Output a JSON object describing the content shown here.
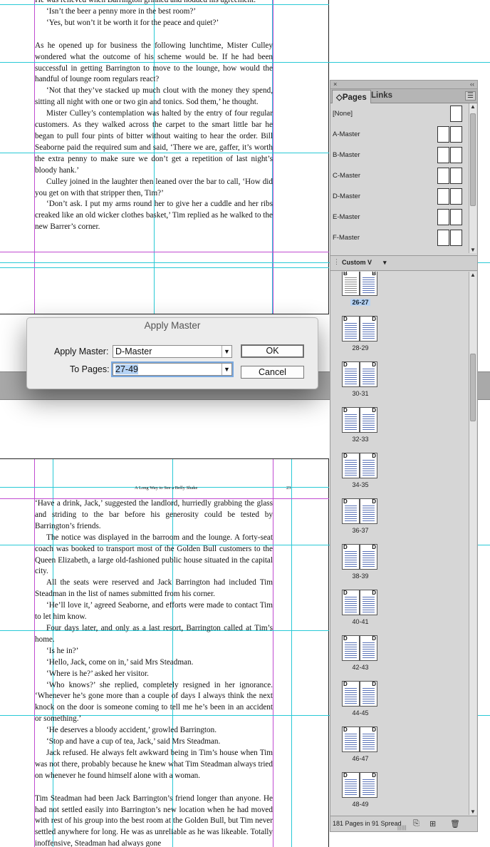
{
  "document": {
    "top_text": [
      {
        "cls": "noind",
        "text": "He was relieved when Barrington grinned and nodded his agreement."
      },
      {
        "cls": "",
        "text": "‘Isn’t the beer a penny more in the best room?’"
      },
      {
        "cls": "",
        "text": "‘Yes, but won’t it be worth it for the peace and quiet?’"
      },
      {
        "cls": "noind gap",
        "text": "As he opened up for business the following lunchtime, Mister Culley wondered what the outcome of his scheme would be. If he had been successful in getting Barrington to move to the lounge, how would the handful of lounge room regulars react?"
      },
      {
        "cls": "",
        "text": "‘Not that they’ve stacked up much clout with the money they spend, sitting all night with one or two gin and tonics. Sod them,’ he thought."
      },
      {
        "cls": "",
        "text": "Mister Culley’s contemplation was halted by the entry of four regular customers. As they walked across the carpet to the smart little bar he began to pull four pints of bitter without waiting to hear the order. Bill Seaborne paid the required sum and said, ‘There we are, gaffer, it’s worth the extra penny to make sure we don’t get a repetition of last night’s bloody hank.’"
      },
      {
        "cls": "",
        "text": "Culley joined in the laughter then leaned over the bar to call, ‘How did you get on with that stripper then, Tim?’"
      },
      {
        "cls": "",
        "text": "‘Don’t ask. I put my arms round her to give her a cuddle and her ribs creaked like an old wicker clothes basket,’ Tim replied as he walked to the new Barrer’s corner."
      }
    ],
    "running_head": "A Long Way to See a Belly Shake",
    "folio": "23",
    "bottom_text": [
      {
        "cls": "noind",
        "text": "‘Have a drink, Jack,’ suggested the landlord, hurriedly grabbing the glass and striding to the bar before his generosity could be tested by Barrington’s friends."
      },
      {
        "cls": "",
        "text": "The notice was displayed in the barroom and the lounge. A forty-seat coach was booked to transport most of the Golden Bull customers to the Queen Elizabeth, a large old-fashioned public house situated in the capital city."
      },
      {
        "cls": "",
        "text": "All the seats were reserved and Jack Barrington had included Tim Steadman in the list of names submitted from his corner."
      },
      {
        "cls": "",
        "text": "‘He’ll love it,’ agreed Seaborne, and efforts were made to contact Tim to let him know."
      },
      {
        "cls": "",
        "text": "Four days later, and only as a last resort, Barrington called at Tim’s home."
      },
      {
        "cls": "",
        "text": "‘Is he in?’"
      },
      {
        "cls": "",
        "text": "‘Hello, Jack, come on in,’ said Mrs Steadman."
      },
      {
        "cls": "",
        "text": "‘Where is he?’ asked her visitor."
      },
      {
        "cls": "",
        "text": "‘Who knows?’ she replied, completely resigned in her ignorance. ‘Whenever he’s gone more than a couple of days I always think the next knock on the door is someone coming to tell me he’s been in an accident or something.’"
      },
      {
        "cls": "",
        "text": "‘He deserves a bloody accident,’ growled Barrington."
      },
      {
        "cls": "",
        "text": "‘Stop and have a cup of tea, Jack,’ said Mrs Steadman."
      },
      {
        "cls": "",
        "text": "Jack refused. He always felt awkward being in Tim’s house when Tim was not there, probably because he knew what Tim Steadman always tried on whenever he found himself alone with a woman."
      },
      {
        "cls": "noind gap",
        "text": "Tim Steadman had been Jack Barrington’s friend longer than anyone. He had not settled easily into Barrington’s new location when he had moved with rest of his group into the best room at the Golden Bull, but Tim never settled anywhere for long. He was as unreliable as he was likeable. Totally inoffensive, Steadman had always gone"
      }
    ]
  },
  "dialog": {
    "title": "Apply Master",
    "apply_master_label": "Apply Master:",
    "apply_master_value": "D-Master",
    "to_pages_label": "To Pages:",
    "to_pages_value": "27-49",
    "ok_label": "OK",
    "cancel_label": "Cancel"
  },
  "panel": {
    "close_glyph": "×",
    "collapse_glyph": "‹‹",
    "tab_pages": "◇Pages",
    "tab_links": "Links",
    "menu_glyph": "☰",
    "masters": [
      {
        "label": "[None]",
        "single": true
      },
      {
        "label": "A-Master",
        "single": false
      },
      {
        "label": "B-Master",
        "single": false
      },
      {
        "label": "C-Master",
        "single": false
      },
      {
        "label": "D-Master",
        "single": false
      },
      {
        "label": "E-Master",
        "single": false
      },
      {
        "label": "F-Master",
        "single": false
      }
    ],
    "view_label": "Custom V",
    "spreads": [
      {
        "label": "26-27",
        "master": "B",
        "first": true,
        "current": true
      },
      {
        "label": "28-29",
        "master": "D"
      },
      {
        "label": "30-31",
        "master": "D"
      },
      {
        "label": "32-33",
        "master": "D"
      },
      {
        "label": "34-35",
        "master": "D"
      },
      {
        "label": "36-37",
        "master": "D"
      },
      {
        "label": "38-39",
        "master": "D"
      },
      {
        "label": "40-41",
        "master": "D"
      },
      {
        "label": "42-43",
        "master": "D"
      },
      {
        "label": "44-45",
        "master": "D"
      },
      {
        "label": "46-47",
        "master": "D"
      },
      {
        "label": "48-49",
        "master": "D"
      }
    ],
    "footer_text": "181 Pages in 91 Spread",
    "footer_new_icon": "new-page-icon",
    "footer_trash_icon": "trash-icon"
  }
}
